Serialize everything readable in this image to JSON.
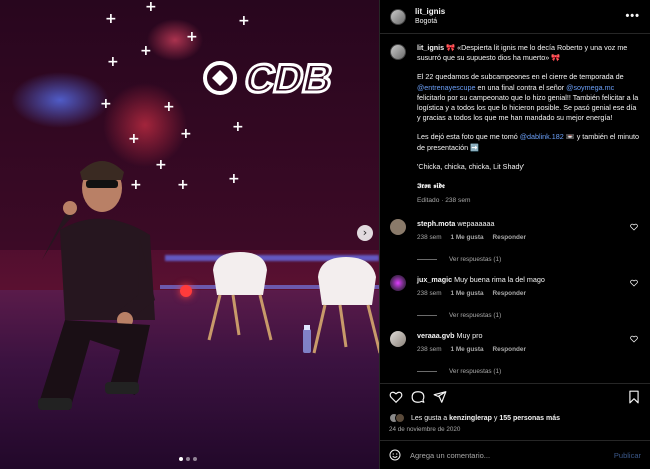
{
  "header": {
    "username": "lit_ignis",
    "location": "Bogotá",
    "more_icon": "more-horizontal-icon"
  },
  "caption": {
    "username": "lit_ignis",
    "line1": " 🎀 «Despierta lit ignis me lo decía Roberto y una voz me susurró que su supuesto dios ha muerto» 🎀",
    "para2_a": "El 22 quedamos de subcampeones en el cierre de temporada de ",
    "mention1": "@entrenayescupe",
    "para2_b": " en una final contra el señor ",
    "mention2": "@soymega.mc",
    "para2_c": " felicitarlo por su campeonato que lo hizo genial!! También felicitar a la logística y a todos los que lo hicieron posible. Se pasó genial ese día y gracias a todos los que me han mandado su mejor energía!",
    "para3_a": "Les dejó esta foto que me tomó ",
    "mention3": "@dablink.182",
    "para3_b": " 📼 y también el minuto de presentación ➡️",
    "quote": "'Chicka, chicka, chicka, Lit Shady'",
    "signature": "𝕴𝖗𝖔𝖓 𝖘𝖎𝖉𝖊",
    "meta": "Editado · 238 sem"
  },
  "comments": [
    {
      "username": "steph.mota",
      "text": " wepaaaaaa",
      "time": "238 sem",
      "likes": "1 Me gusta",
      "reply": "Responder",
      "view_replies": "Ver respuestas (1)",
      "avatar_color": "#8a7a6a"
    },
    {
      "username": "jux_magic",
      "text": " Muy buena rima la del mago",
      "time": "238 sem",
      "likes": "1 Me gusta",
      "reply": "Responder",
      "view_replies": "Ver respuestas (1)",
      "avatar_color": "#5b2b6b"
    },
    {
      "username": "veraaa.gvb",
      "text": " Muy pro",
      "time": "238 sem",
      "likes": "1 Me gusta",
      "reply": "Responder",
      "view_replies": "Ver respuestas (1)",
      "avatar_color": "#b0a8a0"
    }
  ],
  "likes": {
    "prefix": "Les gusta a ",
    "user": "kenzinglerap",
    "middle": " y ",
    "others": "155 personas más"
  },
  "date": "24 de noviembre de 2020",
  "add_comment": {
    "placeholder": "Agrega un comentario...",
    "post_label": "Publicar"
  },
  "photo": {
    "logo_text": "CDB",
    "carousel_count": 3,
    "carousel_active": 1
  },
  "colors": {
    "link": "#6b9ff7",
    "muted": "#a8a8a8",
    "background": "#000000"
  }
}
